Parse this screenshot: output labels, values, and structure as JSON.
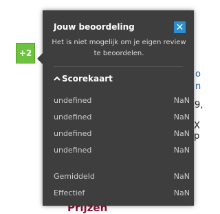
{
  "badge": {
    "label": "+2",
    "color": "#6dc23e"
  },
  "popup": {
    "title": "Jouw beoordeling",
    "close_icon": "close-icon",
    "message": "Het is niet mogelijk om je eigen review te beoordelen.",
    "scorecard": {
      "title": "Scorekaart",
      "rows": [
        {
          "label": "undefined",
          "value": "NaN"
        },
        {
          "label": "undefined",
          "value": "NaN"
        },
        {
          "label": "undefined",
          "value": "NaN"
        },
        {
          "label": "undefined",
          "value": "NaN"
        }
      ]
    },
    "summary": [
      {
        "label": "Gemiddeld",
        "value": "NaN"
      },
      {
        "label": "Effectief",
        "value": "NaN"
      }
    ]
  },
  "background": {
    "fragments": [
      "o",
      "n",
      "9,",
      "X p"
    ],
    "bottom_heading": "Prijzen"
  }
}
